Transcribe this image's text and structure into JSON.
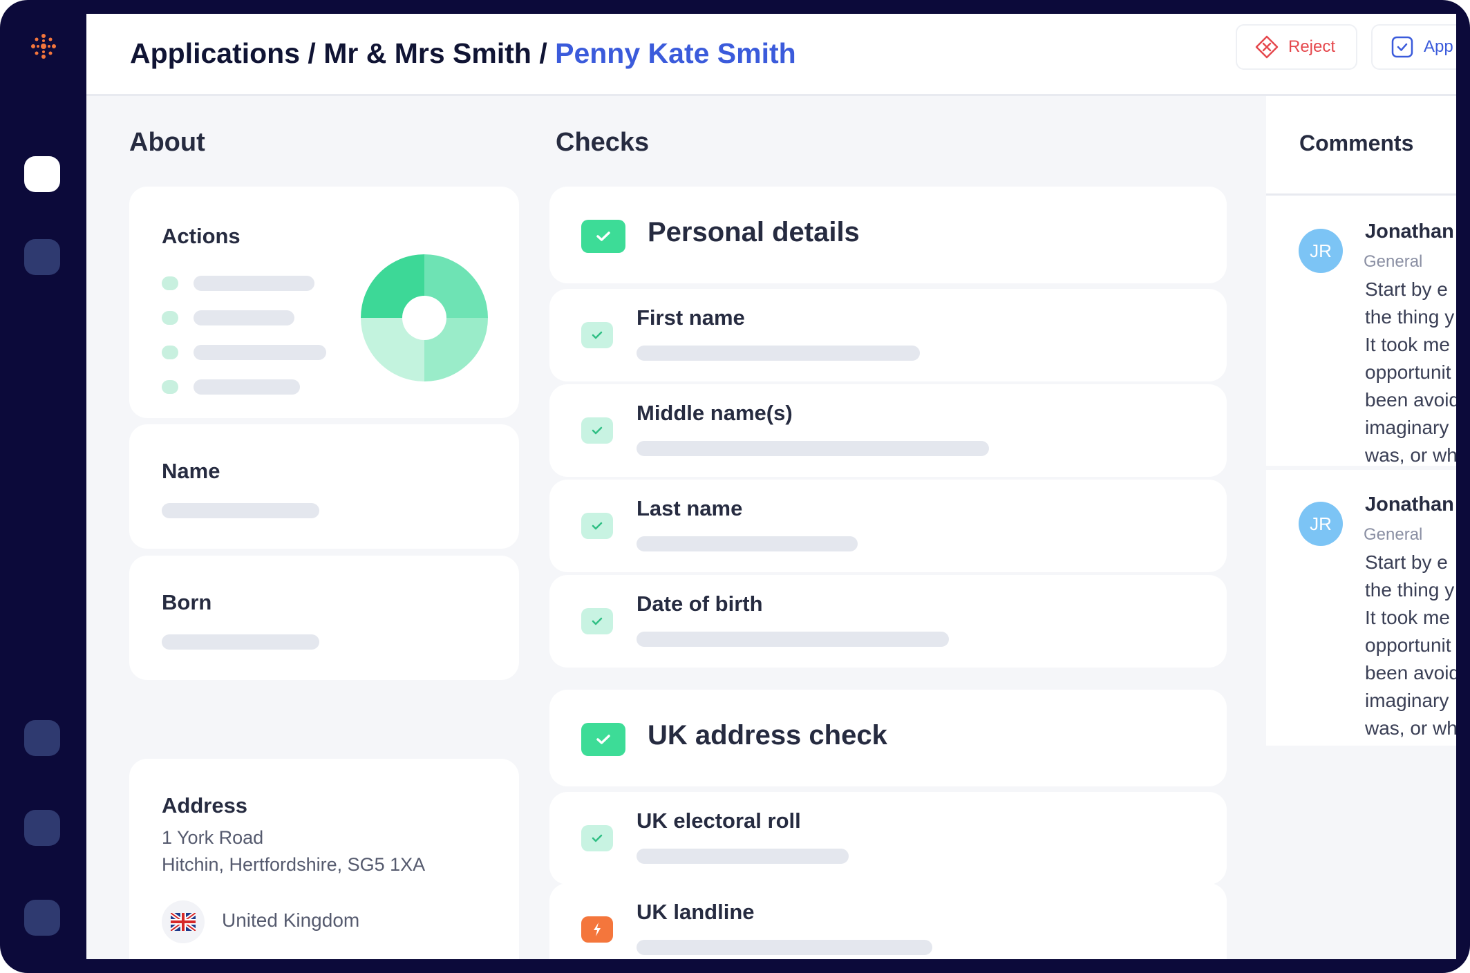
{
  "breadcrumb": {
    "part1": "Applications",
    "sep1": " / ",
    "part2": "Mr & Mrs Smith",
    "sep2": " / ",
    "current": "Penny Kate Smith"
  },
  "toolbar": {
    "reject_label": "Reject",
    "approve_label": "App"
  },
  "about": {
    "title": "About",
    "actions_label": "Actions",
    "name_label": "Name",
    "born_label": "Born",
    "address_label": "Address",
    "address_line1": "1 York Road",
    "address_line2": "Hitchin, Hertfordshire, SG5 1XA",
    "country": "United Kingdom"
  },
  "checks": {
    "title": "Checks",
    "sections": [
      {
        "title": "Personal details",
        "items": [
          "First name",
          "Middle name(s)",
          "Last name",
          "Date of birth"
        ]
      },
      {
        "title": "UK address check",
        "items": [
          "UK electoral roll",
          "UK landline"
        ]
      }
    ]
  },
  "comments": {
    "title": "Comments",
    "list": [
      {
        "initials": "JR",
        "author": "Jonathan",
        "tag": "General",
        "lines": [
          "Start by e",
          "the thing y",
          "It took me",
          "opportunit",
          "been avoid",
          "imaginary",
          "was, or wh"
        ]
      },
      {
        "initials": "JR",
        "author": "Jonathan",
        "tag": "General",
        "lines": [
          "Start by e",
          "the thing y",
          "It took me",
          "opportunit",
          "been avoid",
          "imaginary",
          "was, or wh"
        ]
      }
    ]
  },
  "icons": {
    "logo": "spark-logo-icon",
    "reject": "x-circle-icon",
    "approve": "check-square-icon",
    "check": "check-icon",
    "warning": "lightning-icon",
    "flag": "uk-flag-icon"
  },
  "colors": {
    "accent": "#3b5bdb",
    "success": "#3ddc97",
    "danger": "#e5484d",
    "warning": "#f4763c",
    "rail": "#0c0a3a"
  },
  "donut": {
    "segments": [
      0.25,
      0.25,
      0.25,
      0.25
    ]
  }
}
